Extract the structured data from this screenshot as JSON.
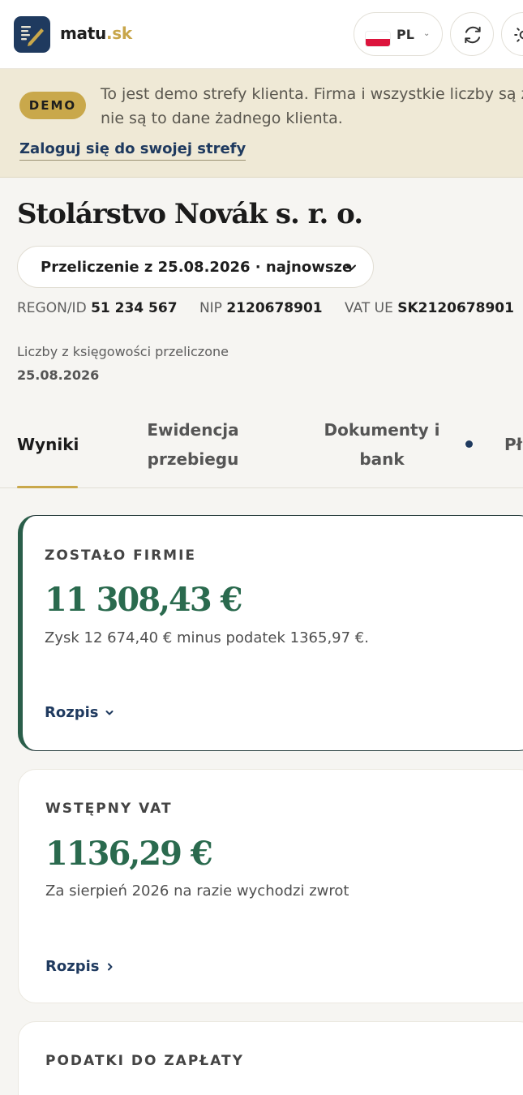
{
  "header": {
    "brand_name": "matu",
    "brand_tld": ".sk",
    "language": "PL",
    "icons": [
      "logo-icon",
      "poland-flag-icon",
      "chevron-down-icon",
      "refresh-icon",
      "sun-icon"
    ]
  },
  "banner": {
    "badge": "DEMO",
    "text": "To jest demo strefy klienta. Firma i wszystkie liczby są zmyślone – nie są to dane żadnego klienta.",
    "login_link": "Zaloguj się do swojej strefy"
  },
  "company": {
    "name": "Stolárstvo Novák s. r. o.",
    "recalc_select": "Przeliczenie z 25.08.2026 · najnowsze",
    "regon_label": "REGON/ID",
    "regon_value": "51 234 567",
    "nip_label": "NIP",
    "nip_value": "2120678901",
    "vat_label": "VAT UE",
    "vat_value": "SK2120678901",
    "recalc_label": "Liczby z księgowości przeliczone",
    "recalc_date": "25.08.2026"
  },
  "tabs": [
    {
      "label": "Wyniki",
      "active": true
    },
    {
      "label": "Ewidencja przebiegu",
      "active": false
    },
    {
      "label": "Dokumenty i bank",
      "active": false,
      "notification": true
    },
    {
      "label": "Pła",
      "active": false
    }
  ],
  "cards": [
    {
      "title": "ZOSTAŁO FIRMIE",
      "value": "11 308,43 €",
      "description": "Zysk 12 674,40 € minus podatek 1365,97 €.",
      "link": "Rozpis"
    },
    {
      "title": "WSTĘPNY VAT",
      "value": "1136,29 €",
      "description": "Za sierpień 2026 na razie wychodzi zwrot",
      "link": "Rozpis"
    },
    {
      "title": "PODATKI DO ZAPŁATY"
    }
  ],
  "colors": {
    "brand_navy": "#1f3a5f",
    "brand_gold": "#c9a84b",
    "value_green": "#2a6a4e",
    "banner_bg": "#efe9d6"
  }
}
